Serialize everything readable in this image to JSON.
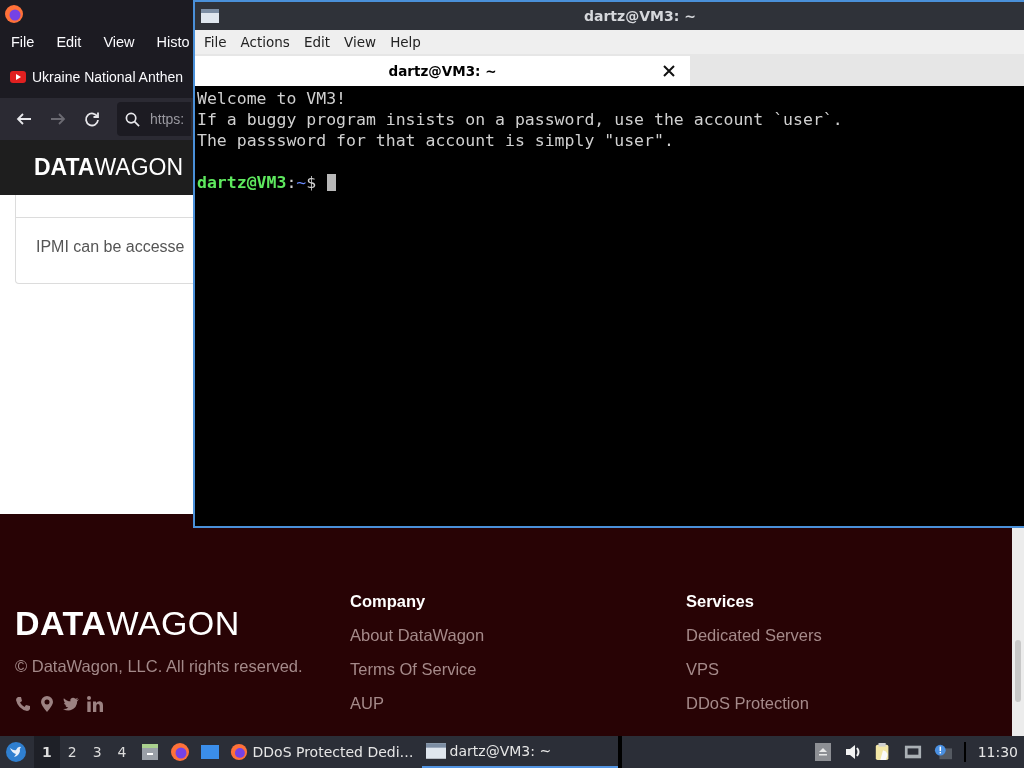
{
  "browser": {
    "menu": [
      "File",
      "Edit",
      "View",
      "Histo"
    ],
    "bookmark": "Ukraine National Anthen",
    "nav_buttons": [
      {
        "kind": "back",
        "disabled": false
      },
      {
        "kind": "forward",
        "disabled": true
      },
      {
        "kind": "reload",
        "disabled": false
      }
    ],
    "url": "https:",
    "site_logo": {
      "bold": "DATA",
      "light": "WAGON"
    },
    "card_text": "IPMI can be accesse",
    "footer": {
      "logo": {
        "bold": "DATA",
        "light": "WAGON"
      },
      "copyright": "© DataWagon, LLC. All rights reserved.",
      "columns": [
        {
          "heading": "Company",
          "links": [
            "About DataWagon",
            "Terms Of Service",
            "AUP"
          ]
        },
        {
          "heading": "Services",
          "links": [
            "Dedicated Servers",
            "VPS",
            "DDoS Protection"
          ]
        }
      ]
    }
  },
  "terminal": {
    "title": "dartz@VM3: ~",
    "menu": [
      "File",
      "Actions",
      "Edit",
      "View",
      "Help"
    ],
    "tabs": [
      {
        "label": "dartz@VM3: ~",
        "selected": true
      }
    ],
    "lines": [
      "Welcome to VM3!",
      "If a buggy program insists on a password, use the account `user`.",
      "The passsword for that account is simply \"user\"."
    ],
    "prompt": {
      "user_host": "dartz@VM3",
      "separator": ":",
      "path": "~",
      "symbol": "$"
    }
  },
  "taskbar": {
    "workspaces": [
      {
        "label": "1",
        "selected": true
      },
      {
        "label": "2",
        "selected": false
      },
      {
        "label": "3",
        "selected": false
      },
      {
        "label": "4",
        "selected": false
      }
    ],
    "tasks": [
      {
        "kind": "browser",
        "label": "DDoS Protected Dedi…",
        "selected": false
      },
      {
        "kind": "terminal",
        "label": "dartz@VM3: ~",
        "selected": true
      }
    ],
    "clock": "11:30"
  }
}
